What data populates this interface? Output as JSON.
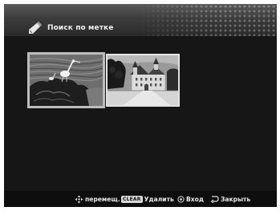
{
  "header": {
    "title": "Поиск по метке",
    "icon": "pen-icon"
  },
  "thumbnails": [
    {
      "subject": "bird on rock",
      "selected": true
    },
    {
      "subject": "castle",
      "selected": false
    }
  ],
  "footer": {
    "move_icon": "arrow-keys-icon",
    "move_label": "перемещ.",
    "clear_key": "CLEAR",
    "delete_label": "Удалить",
    "enter_icon": "enter-button-icon",
    "enter_label": "Вход",
    "close_icon": "return-icon",
    "close_label": "Закрыть"
  }
}
